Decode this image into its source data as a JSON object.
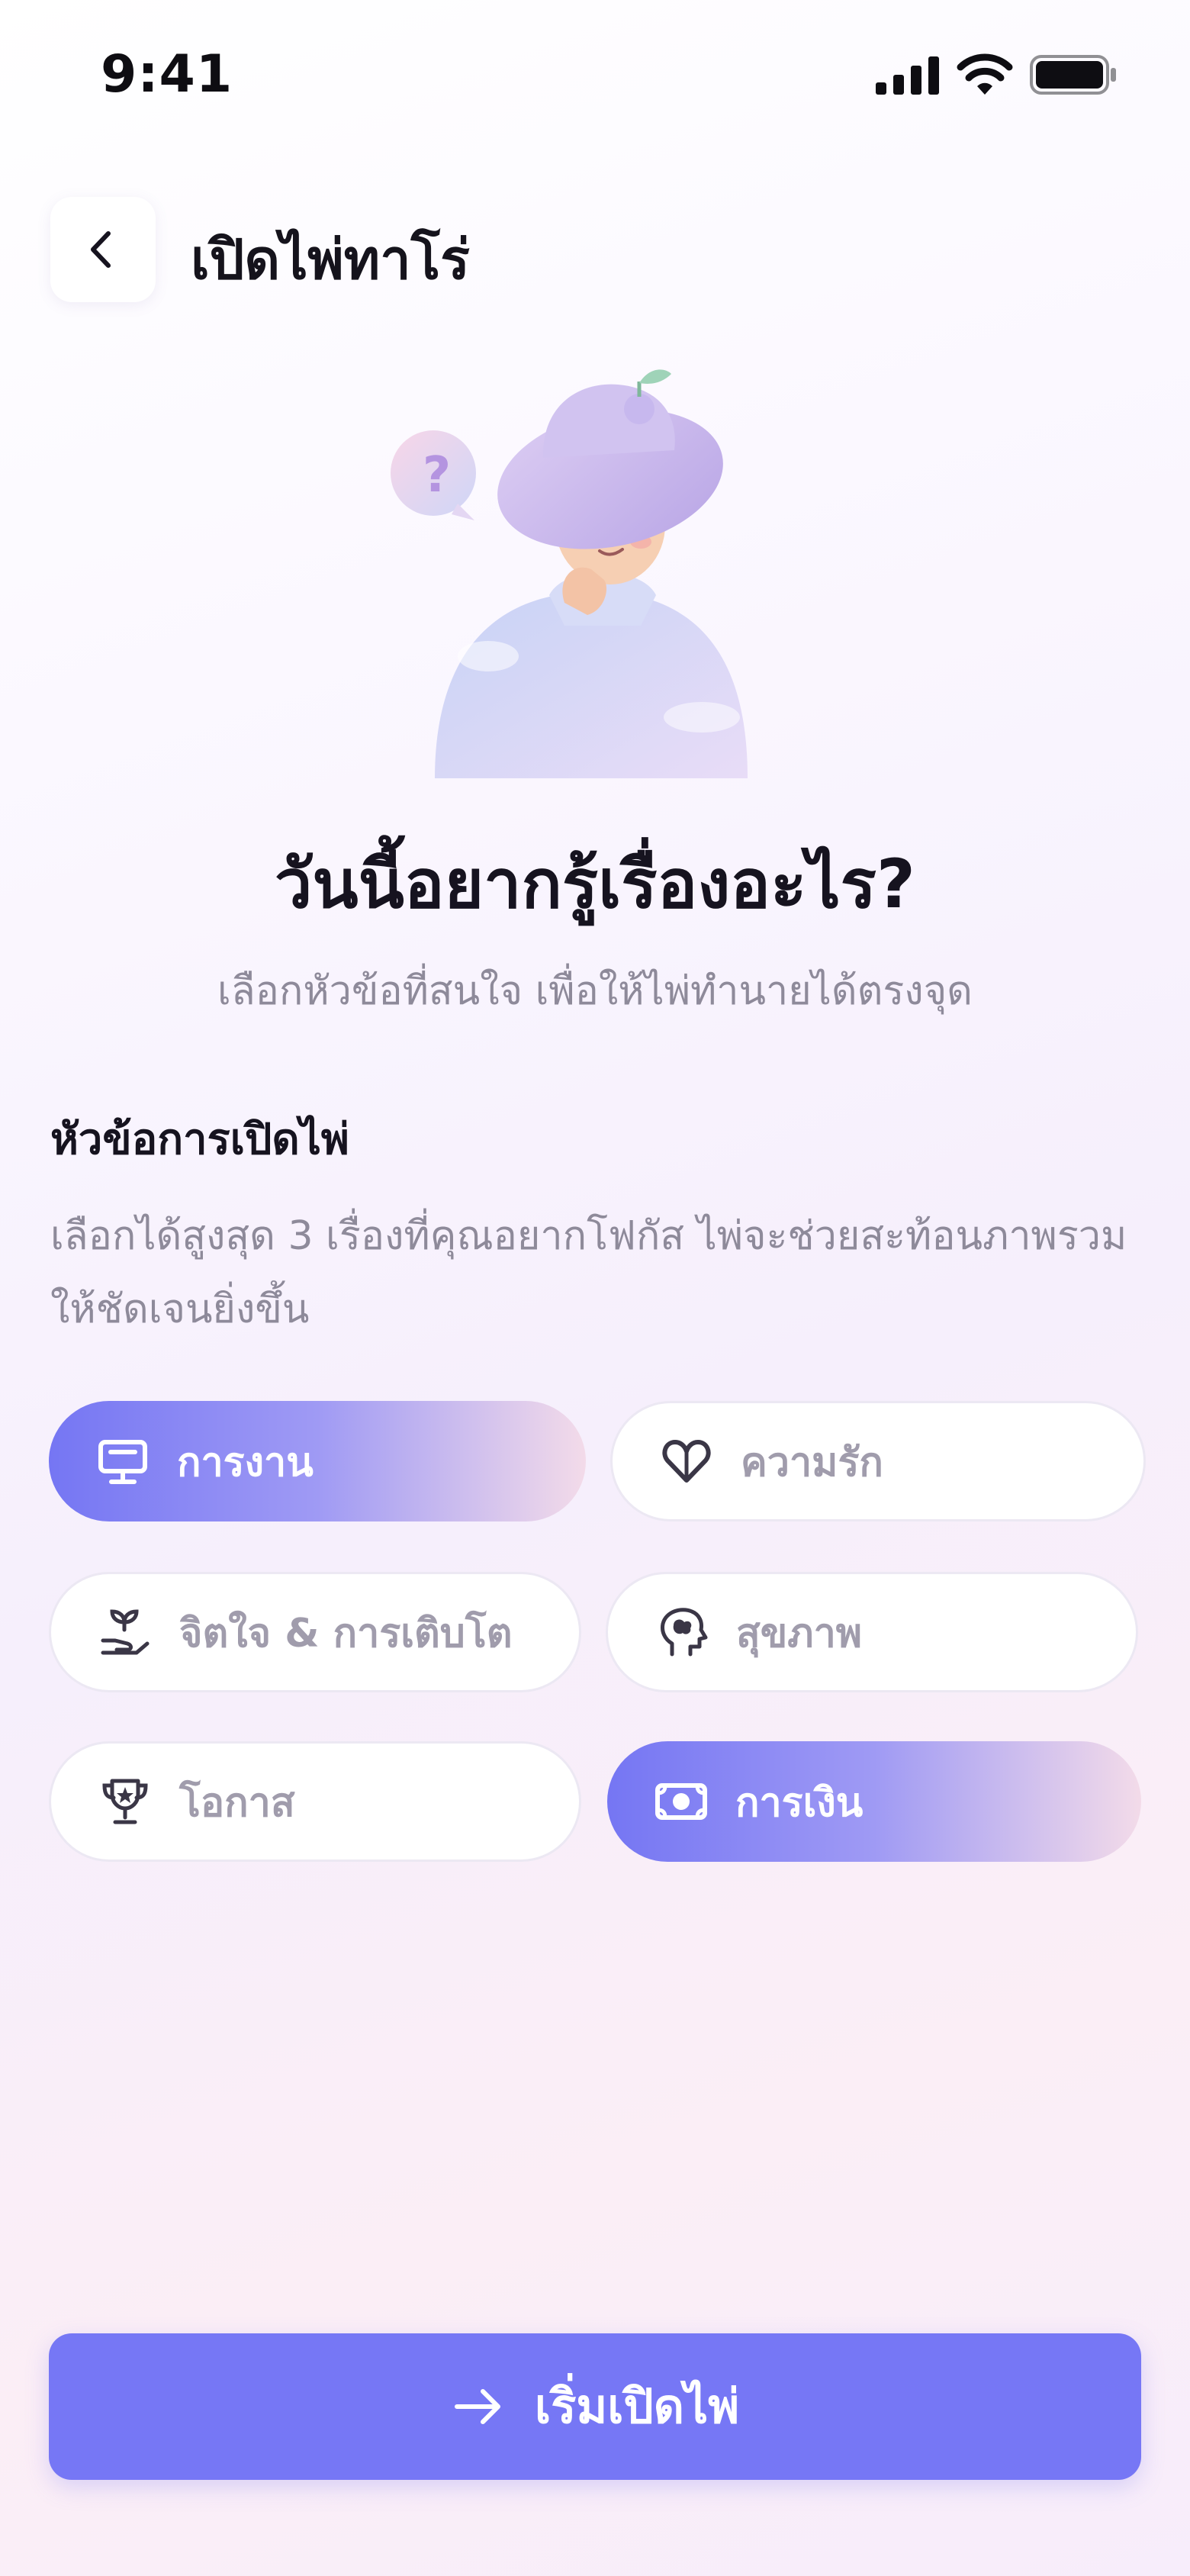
{
  "status_bar": {
    "time": "9:41"
  },
  "header": {
    "title": "เปิดไพ่ทาโร่",
    "back_icon": "chevron-left-icon"
  },
  "hero": {
    "title": "วันนี้อยากรู้เรื่องอะไร?",
    "subtitle": "เลือกหัวข้อที่สนใจ เพื่อให้ไพ่ทำนายได้ตรงจุด"
  },
  "topics": {
    "title": "หัวข้อการเปิดไพ่",
    "description": "เลือกได้สูงสุด 3 เรื่องที่คุณอยากโฟกัส ไพ่จะช่วยสะท้อนภาพรวมให้ชัดเจนยิ่งขึ้น",
    "items": [
      {
        "label": "การงาน",
        "icon": "monitor-icon",
        "selected": true
      },
      {
        "label": "ความรัก",
        "icon": "heart-icon",
        "selected": false
      },
      {
        "label": "จิตใจ & การเติบโต",
        "icon": "sprout-hand-icon",
        "selected": false
      },
      {
        "label": "สุขภาพ",
        "icon": "brain-head-icon",
        "selected": false
      },
      {
        "label": "โอกาส",
        "icon": "trophy-icon",
        "selected": false
      },
      {
        "label": "การเงิน",
        "icon": "banknote-icon",
        "selected": true
      }
    ]
  },
  "start_button": {
    "label": "เริ่มเปิดไพ่",
    "icon": "arrow-right-icon"
  },
  "colors": {
    "accent": "#7677f5",
    "chip_gradient_end": "#f3dbe9",
    "text_primary": "#16131f",
    "text_secondary": "#8e8a9a"
  }
}
